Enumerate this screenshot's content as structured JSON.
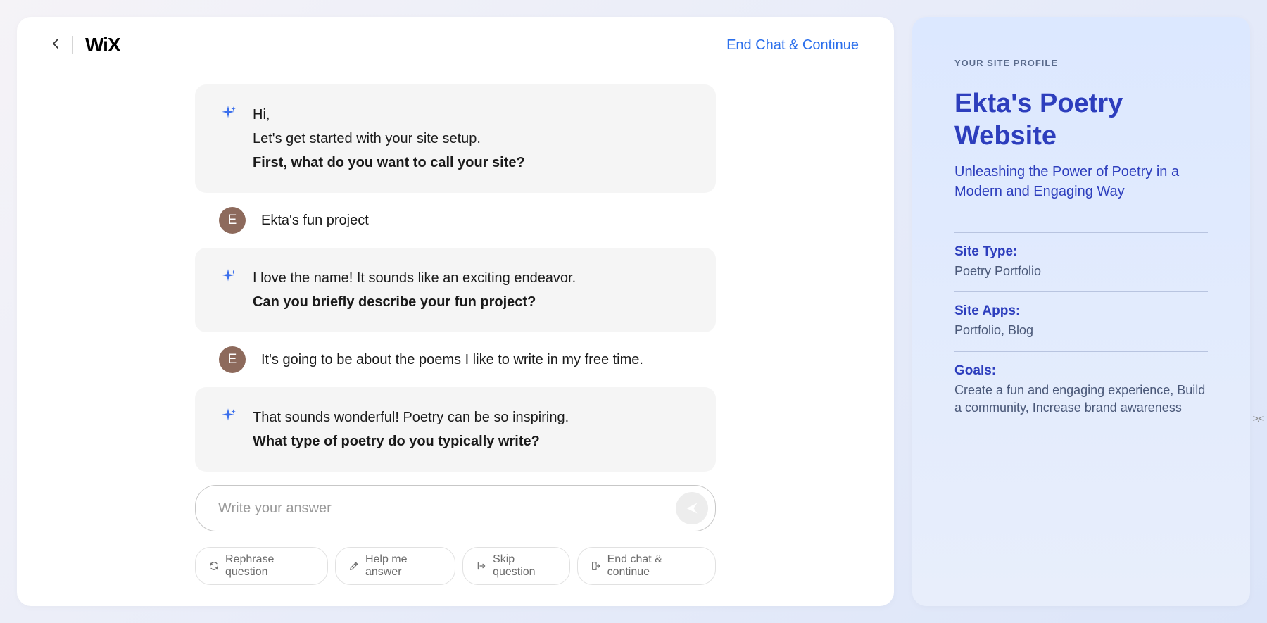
{
  "header": {
    "logo": "WiX",
    "end_chat_link": "End Chat & Continue"
  },
  "chat": {
    "messages": [
      {
        "role": "ai",
        "lines": [
          {
            "text": "Hi,",
            "bold": false
          },
          {
            "text": "Let's get started with your site setup.",
            "bold": false
          },
          {
            "text": "First, what do you want to call your site?",
            "bold": true
          }
        ]
      },
      {
        "role": "user",
        "avatar_initial": "E",
        "text": "Ekta's fun project"
      },
      {
        "role": "ai",
        "lines": [
          {
            "text": "I love the name! It sounds like an exciting endeavor.",
            "bold": false
          },
          {
            "text": "Can you briefly describe your fun project?",
            "bold": true
          }
        ]
      },
      {
        "role": "user",
        "avatar_initial": "E",
        "text": "It's going to be about the poems I like to write in my free time."
      },
      {
        "role": "ai",
        "lines": [
          {
            "text": "That sounds wonderful! Poetry can be so inspiring.",
            "bold": false
          },
          {
            "text": "What type of poetry do you typically write?",
            "bold": true
          }
        ]
      }
    ]
  },
  "input": {
    "placeholder": "Write your answer"
  },
  "action_chips": {
    "rephrase": "Rephrase question",
    "help": "Help me answer",
    "skip": "Skip question",
    "end": "End chat & continue"
  },
  "profile": {
    "label": "YOUR SITE PROFILE",
    "title": "Ekta's Poetry Website",
    "subtitle": "Unleashing the Power of Poetry in a Modern and Engaging Way",
    "items": [
      {
        "label": "Site Type:",
        "value": "Poetry Portfolio"
      },
      {
        "label": "Site Apps:",
        "value": "Portfolio, Blog"
      },
      {
        "label": "Goals:",
        "value": "Create a fun and engaging experience, Build a community, Increase brand awareness"
      }
    ]
  }
}
